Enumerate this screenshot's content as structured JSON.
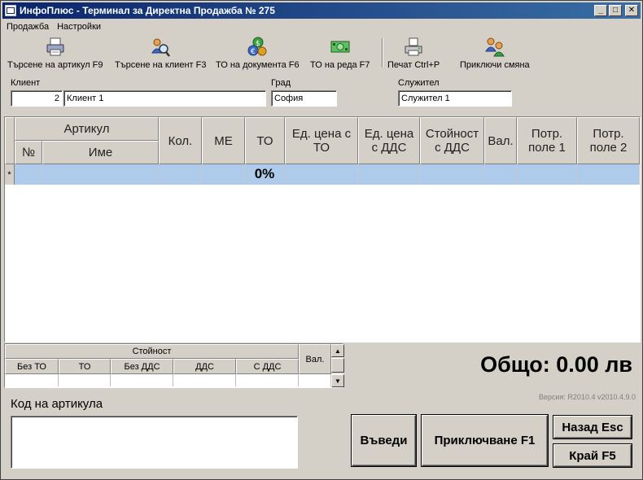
{
  "window": {
    "title": "ИнфоПлюс - Терминал за Директна Продажба № 275"
  },
  "menu": [
    "Продажба",
    "Настройки"
  ],
  "toolbar": {
    "search_article": "Търсене на артикул  F9",
    "search_client": "Търсене на клиент  F3",
    "doc_discount": "ТО на документа  F6",
    "row_discount": "ТО на реда  F7",
    "print": "Печат  Ctrl+P",
    "close_shift": "Приключи смяна"
  },
  "client": {
    "label": "Клиент",
    "number": "2",
    "name": "Клиент 1"
  },
  "city": {
    "label": "Град",
    "value": "София"
  },
  "employee": {
    "label": "Служител",
    "value": "Служител 1"
  },
  "grid": {
    "article_group": "Артикул",
    "col_no": "№",
    "col_name": "Име",
    "col_qty": "Кол.",
    "col_unit": "МЕ",
    "col_to": "ТО",
    "col_price_to": "Ед. цена с ТО",
    "col_price_vat": "Ед. цена с ДДС",
    "col_value_vat": "Стойност с ДДС",
    "col_cur": "Вал.",
    "col_user1": "Потр. поле 1",
    "col_user2": "Потр. поле 2",
    "new_row_marker": "*",
    "new_row_to": "0%"
  },
  "summary": {
    "group": "Стойност",
    "no_to": "Без ТО",
    "to": "ТО",
    "no_vat": "Без ДДС",
    "vat": "ДДС",
    "with_vat": "С ДДС",
    "cur": "Вал."
  },
  "total": "Общо: 0.00 лв",
  "version": "Версия: R2010.4 v2010.4.9.0",
  "code_label": "Код на артикула",
  "buttons": {
    "enter": "Въведи",
    "finish": "Приключване  F1",
    "back": "Назад  Esc",
    "end": "Край  F5"
  },
  "icons": {
    "search_article": "printer-doc-icon",
    "search_client": "user-magnifier-icon",
    "doc_discount": "currency-coins-icon",
    "row_discount": "banknote-icon",
    "print": "printer-icon",
    "close_shift": "users-swap-icon"
  }
}
